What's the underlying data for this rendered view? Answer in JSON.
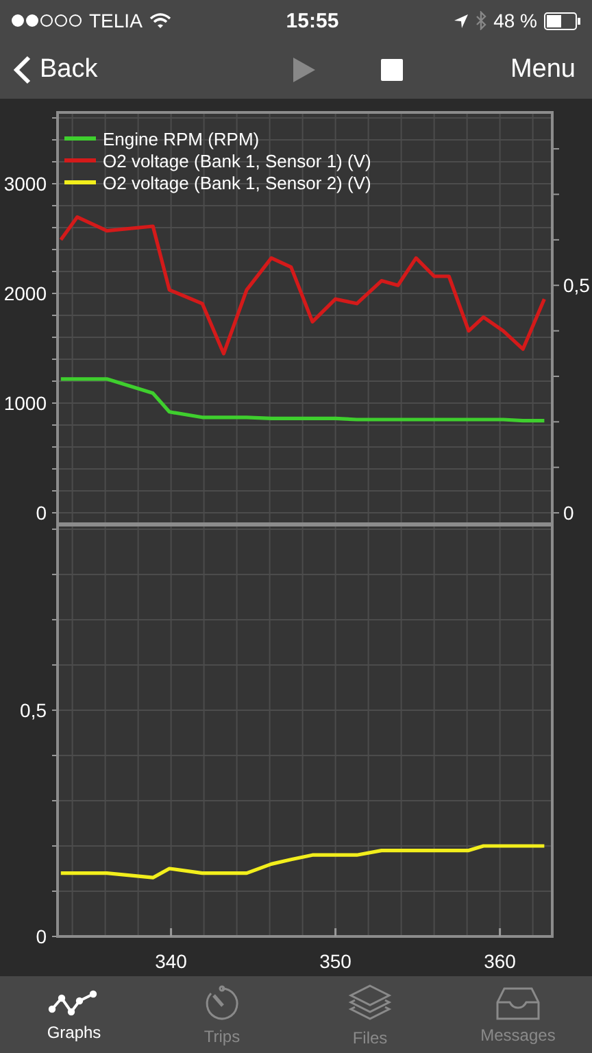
{
  "status_bar": {
    "carrier": "TELIA",
    "time": "15:55",
    "battery": "48 %"
  },
  "nav_bar": {
    "back": "Back",
    "play": {
      "disabled": true
    },
    "menu": "Menu"
  },
  "graphs": [
    {
      "chart_data": {
        "type": "line",
        "grid": true,
        "legend": "upper left",
        "x": [
          333.3,
          334.3,
          336.1,
          338.9,
          339.9,
          341.9,
          343.2,
          344.6,
          346.1,
          347.3,
          348.6,
          350,
          351.3,
          352.8,
          353.8,
          354.9,
          356,
          356.9,
          358.1,
          359,
          360.2,
          361.4,
          362.7
        ],
        "xlim": [
          333.1,
          363.1
        ],
        "ylim": [
          -100,
          3650
        ],
        "yticks": [
          0,
          1000,
          2000,
          3000
        ],
        "y2lim": [
          -0.024,
          0.88
        ],
        "y2ticks": [
          {
            "value": 0,
            "label": "0"
          },
          {
            "value": 0.5,
            "label": "0,5"
          }
        ],
        "series": [
          {
            "name": "Engine RPM (RPM)",
            "color": "#3fcf2e",
            "values": [
              1220,
              1220,
              1220,
              1090,
              920,
              870,
              870,
              870,
              860,
              860,
              860,
              860,
              850,
              850,
              850,
              850,
              850,
              850,
              850,
              850,
              850,
              840,
              840
            ]
          },
          {
            "name": "O2 voltage (Bank 1, Sensor 1) (V)",
            "color": "#d41a1a",
            "axis": "y2",
            "values": [
              0.6,
              0.65,
              0.62,
              0.63,
              0.49,
              0.46,
              0.35,
              0.49,
              0.56,
              0.54,
              0.42,
              0.47,
              0.46,
              0.51,
              0.5,
              0.56,
              0.52,
              0.52,
              0.4,
              0.43,
              0.4,
              0.36,
              0.47
            ]
          }
        ]
      }
    },
    {
      "chart_data": {
        "type": "line",
        "grid": true,
        "x": [
          333.3,
          334.3,
          336.1,
          338.9,
          339.9,
          341.9,
          343.2,
          344.6,
          346.1,
          347.3,
          348.6,
          350,
          351.3,
          352.8,
          353.8,
          354.9,
          356,
          356.9,
          358.1,
          359,
          360.2,
          361.4,
          362.7
        ],
        "xlim": [
          333.1,
          363.1
        ],
        "ylim": [
          0,
          0.909
        ],
        "xticks": [
          340,
          350,
          360
        ],
        "yticks": [
          {
            "value": 0,
            "label": "0"
          },
          {
            "value": 0.5,
            "label": "0,5"
          }
        ],
        "series": [
          {
            "name": "O2 voltage (Bank 1, Sensor 2) (V)",
            "color": "#f2ee1c",
            "values": [
              0.14,
              0.14,
              0.14,
              0.13,
              0.15,
              0.14,
              0.14,
              0.14,
              0.16,
              0.17,
              0.18,
              0.18,
              0.18,
              0.19,
              0.19,
              0.19,
              0.19,
              0.19,
              0.19,
              0.2,
              0.2,
              0.2,
              0.2
            ]
          }
        ]
      }
    }
  ],
  "tab_bar": [
    {
      "label": "Graphs",
      "kind": "graphs",
      "selected": true
    },
    {
      "label": "Trips",
      "kind": "trips",
      "selected": false
    },
    {
      "label": "Files",
      "kind": "files",
      "selected": false
    },
    {
      "label": "Messages",
      "kind": "messages",
      "selected": false
    }
  ]
}
